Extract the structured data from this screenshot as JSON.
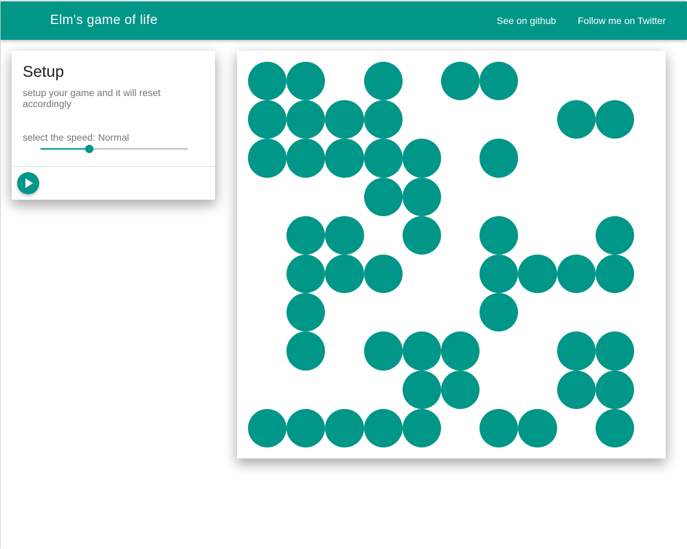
{
  "app": {
    "title": "Elm's game of life",
    "accent_color": "#009688",
    "nav": [
      {
        "label": "See on github"
      },
      {
        "label": "Follow me on Twitter"
      }
    ]
  },
  "setup": {
    "title": "Setup",
    "subtitle": "setup your game and it will reset accordingly",
    "speed_label": "select the speed: Normal",
    "speed_fraction": 0.33,
    "play_icon": "play-icon"
  },
  "board": {
    "rows": 10,
    "cols": 10,
    "cell_color": "#009688",
    "grid": [
      [
        1,
        1,
        0,
        1,
        0,
        1,
        1,
        0,
        0,
        0
      ],
      [
        1,
        1,
        1,
        1,
        0,
        0,
        0,
        0,
        1,
        1
      ],
      [
        1,
        1,
        1,
        1,
        1,
        0,
        1,
        0,
        0,
        0
      ],
      [
        0,
        0,
        0,
        1,
        1,
        0,
        0,
        0,
        0,
        0
      ],
      [
        0,
        1,
        1,
        0,
        1,
        0,
        1,
        0,
        0,
        1
      ],
      [
        0,
        1,
        1,
        1,
        0,
        0,
        1,
        1,
        1,
        1
      ],
      [
        0,
        1,
        0,
        0,
        0,
        0,
        1,
        0,
        0,
        0
      ],
      [
        0,
        1,
        0,
        1,
        1,
        1,
        0,
        0,
        1,
        1
      ],
      [
        0,
        0,
        0,
        0,
        1,
        1,
        0,
        0,
        1,
        1
      ],
      [
        1,
        1,
        1,
        1,
        1,
        0,
        1,
        1,
        0,
        1
      ]
    ]
  }
}
